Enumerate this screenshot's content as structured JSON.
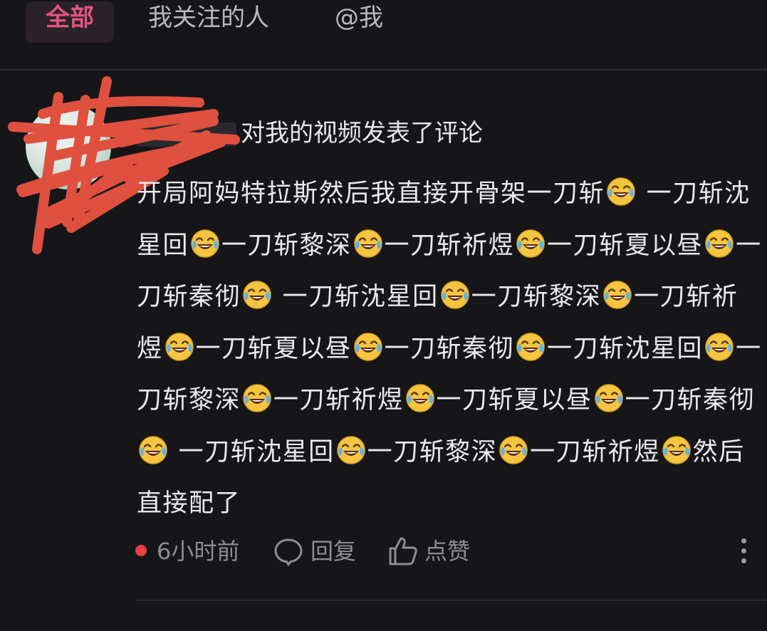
{
  "tabs": [
    {
      "label": "全部",
      "active": true
    },
    {
      "label": "我关注的人",
      "active": false
    },
    {
      "label": "@我",
      "active": false
    }
  ],
  "comment": {
    "action": "对我的视频发表了评论",
    "body": "开局阿妈特拉斯然后我直接开骨架一刀斩😂 一刀斩沈星回😂一刀斩黎深😂一刀斩祈煜😂一刀斩夏以昼😂一刀斩秦彻😂 一刀斩沈星回😂一刀斩黎深😂一刀斩祈煜😂一刀斩夏以昼😂一刀斩秦彻😂一刀斩沈星回😂一刀斩黎深😂一刀斩祈煜😂一刀斩夏以昼😂一刀斩秦彻😂 一刀斩沈星回😂一刀斩黎深😂一刀斩祈煜😂然后直接配了",
    "time": "6小时前",
    "reply_label": "回复",
    "like_label": "点赞"
  },
  "colors": {
    "background": "#161619",
    "active_tab_text": "#e0557f",
    "active_tab_bg": "#2a2228",
    "unread_dot": "#e8403f",
    "redaction": "#e0503f"
  },
  "icons": [
    "reply-bubble-icon",
    "thumbs-up-icon",
    "more-vertical-icon"
  ]
}
